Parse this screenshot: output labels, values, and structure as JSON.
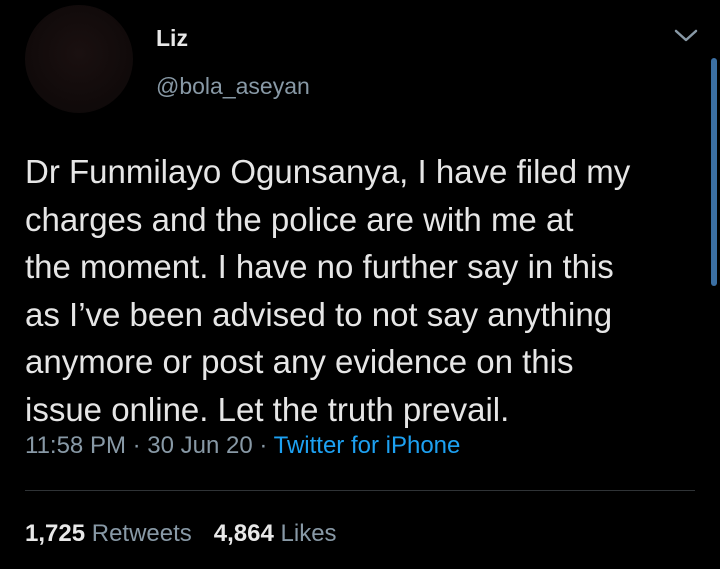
{
  "tweet": {
    "author": {
      "display_name": "Liz",
      "handle": "@bola_aseyan"
    },
    "menu_icon": "chevron-down-icon",
    "text": "Dr Funmilayo Ogunsanya, I have filed my\ncharges and the police are with me at\nthe moment. I have no further say in this\nas I’ve been advised to not say anything\nanymore or post any evidence on this\nissue online. Let the truth prevail.",
    "time": "11:58 PM",
    "separator": " · ",
    "date": "30 Jun 20",
    "source": "Twitter for iPhone",
    "retweets": {
      "count": "1,725",
      "label": "Retweets"
    },
    "likes": {
      "count": "4,864",
      "label": "Likes"
    }
  },
  "colors": {
    "background": "#000000",
    "primary_text": "#e6e6e6",
    "secondary_text": "#8899a6",
    "accent": "#1da1f2",
    "divider": "#2f3336",
    "scrollbar": "#3b6fa3"
  }
}
